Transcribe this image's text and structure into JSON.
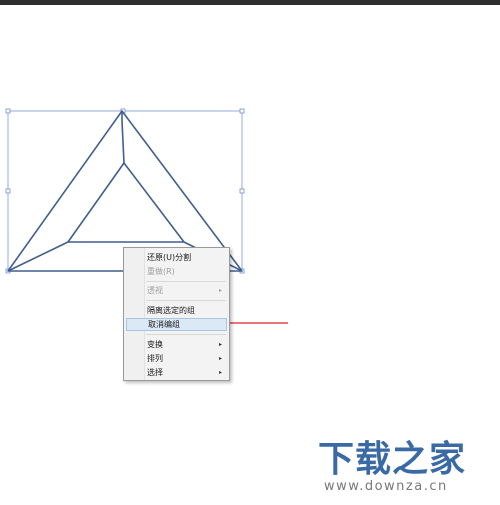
{
  "menu": {
    "items": [
      {
        "label": "还原(U)分割",
        "disabled": false,
        "submenu": false
      },
      {
        "label": "重做(R)",
        "disabled": true,
        "submenu": false
      },
      {
        "label": "透视",
        "disabled": true,
        "submenu": true
      },
      {
        "label": "隔离选定的组",
        "disabled": false,
        "submenu": false
      },
      {
        "label": "取消编组",
        "disabled": false,
        "submenu": false,
        "highlighted": true
      },
      {
        "label": "变换",
        "disabled": false,
        "submenu": true
      },
      {
        "label": "排列",
        "disabled": false,
        "submenu": true
      },
      {
        "label": "选择",
        "disabled": false,
        "submenu": true
      }
    ],
    "submenu_glyph": "▸"
  },
  "watermark": {
    "brand": "下载之家",
    "url": "www.downza.cn"
  },
  "colors": {
    "shape_stroke": "#3f5f8f",
    "selection": "#6f8fcf",
    "arrow": "#e0202a",
    "brand": "#3a6aa6"
  }
}
